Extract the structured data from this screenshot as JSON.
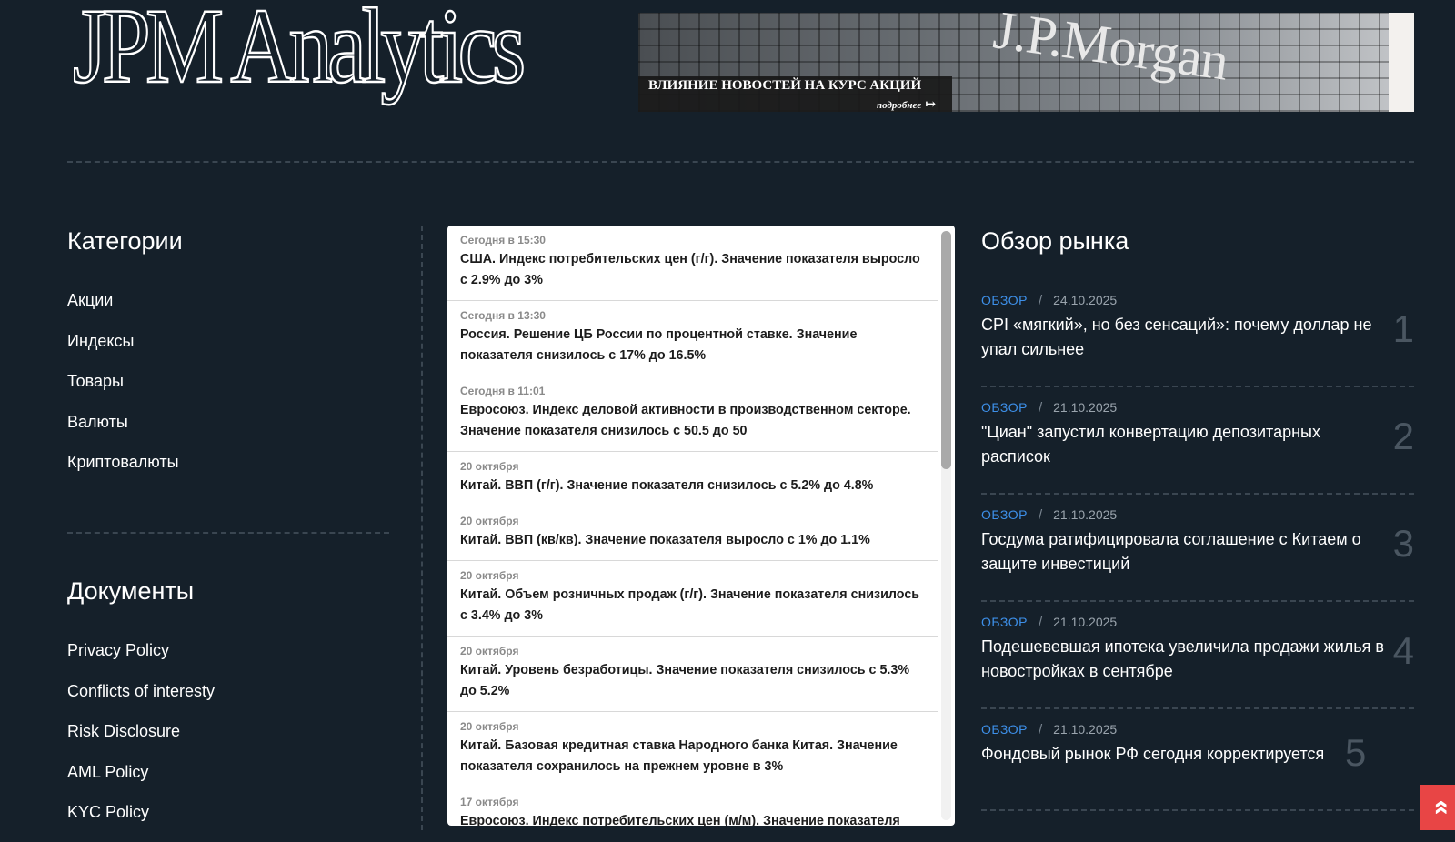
{
  "header": {
    "logo_text": "JPM Analytics",
    "banner": {
      "brand": "J.P.Morgan",
      "title": "ВЛИЯНИЕ НОВОСТЕЙ НА КУРС АКЦИЙ",
      "more": "подробнее",
      "more_arrow": "↦"
    }
  },
  "categories": {
    "title": "Категории",
    "items": [
      {
        "label": "Акции"
      },
      {
        "label": "Индексы"
      },
      {
        "label": "Товары"
      },
      {
        "label": "Валюты"
      },
      {
        "label": "Криптовалюты"
      }
    ]
  },
  "documents": {
    "title": "Документы",
    "items": [
      {
        "label": "Privacy Policy"
      },
      {
        "label": "Conflicts of interesty"
      },
      {
        "label": "Risk Disclosure"
      },
      {
        "label": "AML Policy"
      },
      {
        "label": "KYC Policy"
      }
    ]
  },
  "feed": {
    "items": [
      {
        "time": "Сегодня в 15:30",
        "text": "США. Индекс потребительских цен (г/г). Значение показателя выросло с 2.9% до 3%"
      },
      {
        "time": "Сегодня в 13:30",
        "text": "Россия. Решение ЦБ России по процентной ставке. Значение показателя снизилось с 17% до 16.5%"
      },
      {
        "time": "Сегодня в 11:01",
        "text": "Евросоюз. Индекс деловой активности в производственном секторе. Значение показателя снизилось с 50.5 до 50"
      },
      {
        "time": "20 октября",
        "text": "Китай. ВВП (г/г). Значение показателя снизилось с 5.2% до 4.8%"
      },
      {
        "time": "20 октября",
        "text": "Китай. ВВП (кв/кв). Значение показателя выросло с 1% до 1.1%"
      },
      {
        "time": "20 октября",
        "text": "Китай. Объем розничных продаж (г/г). Значение показателя снизилось с 3.4% до 3%"
      },
      {
        "time": "20 октября",
        "text": "Китай. Уровень безработицы. Значение показателя снизилось с 5.3% до 5.2%"
      },
      {
        "time": "20 октября",
        "text": "Китай. Базовая кредитная ставка Народного банка Китая. Значение показателя сохранилось на прежнем уровне в 3%"
      },
      {
        "time": "17 октября",
        "text": "Евросоюз. Индекс потребительских цен (м/м). Значение показателя"
      }
    ]
  },
  "market": {
    "title": "Обзор рынка",
    "items": [
      {
        "tag": "Обзор",
        "sep": "/",
        "date": "24.10.2025",
        "title": "CPI «мягкий», но без сенсаций»: почему доллар не упал сильнее",
        "num": "1"
      },
      {
        "tag": "Обзор",
        "sep": "/",
        "date": "21.10.2025",
        "title": "\"Циан\" запустил конвертацию депозитарных расписок",
        "num": "2"
      },
      {
        "tag": "Обзор",
        "sep": "/",
        "date": "21.10.2025",
        "title": "Госдума ратифицировала соглашение с Китаем о защите инвестиций",
        "num": "3"
      },
      {
        "tag": "Обзор",
        "sep": "/",
        "date": "21.10.2025",
        "title": "Подешевевшая ипотека увеличила продажи жилья в новостройках в сентябре",
        "num": "4"
      },
      {
        "tag": "Обзор",
        "sep": "/",
        "date": "21.10.2025",
        "title": "Фондовый рынок РФ сегодня корректируется",
        "num": "5"
      }
    ]
  },
  "scroll_top": {
    "icon": "»",
    "icon_name": "double-chevron-up-icon"
  },
  "colors": {
    "background": "#15202a",
    "accent": "#3d8fe8",
    "scroll_top": "#e84545"
  }
}
